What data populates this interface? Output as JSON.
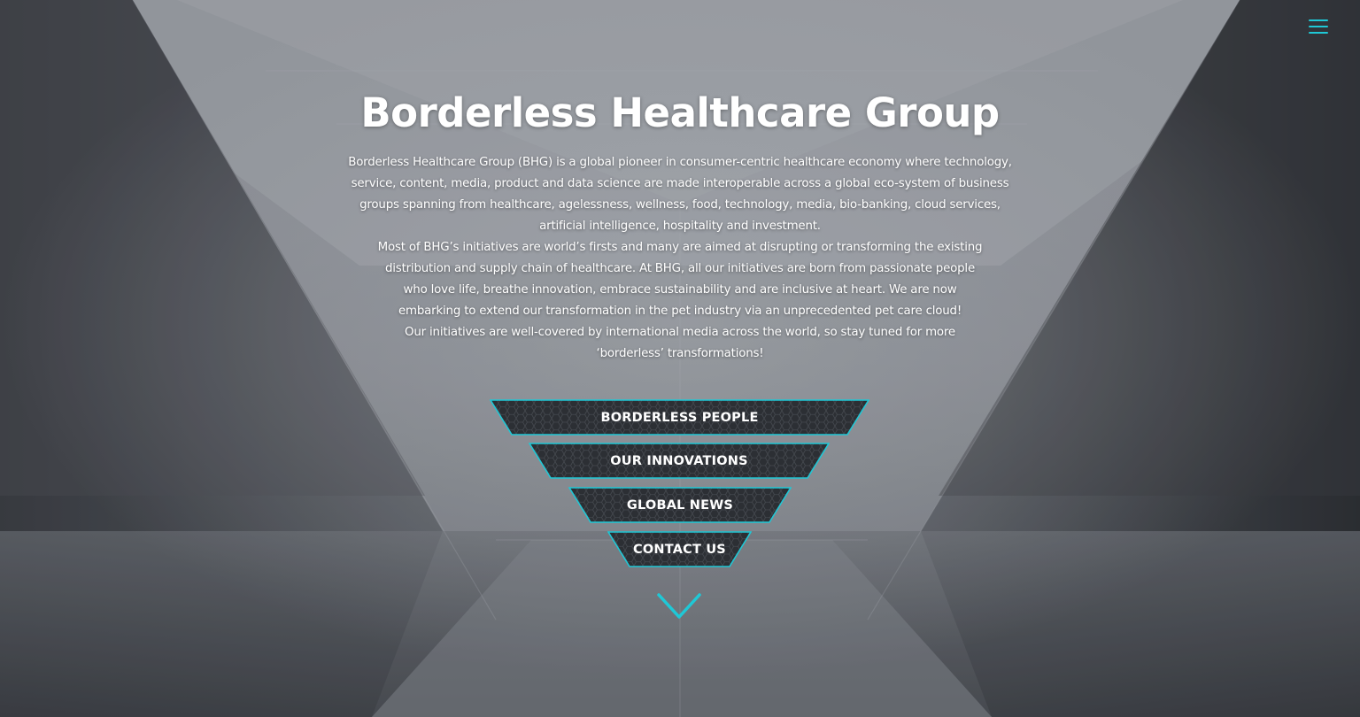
{
  "header": {
    "menu_icon": "hamburger-menu-icon",
    "accent_color": "#1fc8d6"
  },
  "hero": {
    "title": "Borderless Healthcare Group",
    "paragraph_1": "Borderless Healthcare Group (BHG) is a global pioneer in consumer-centric healthcare economy where technology, service, content, media, product and data science are made interoperable across a global eco-system of business groups spanning from healthcare, agelessness, wellness, food, technology, media, bio-banking, cloud services, artificial intelligence, hospitality and investment.",
    "paragraph_2": "Most of BHG’s initiatives are world’s firsts and many are aimed at disrupting or transforming the existing distribution and supply chain of healthcare. At BHG, all our initiatives are born from passionate people who love life, breathe innovation, embrace sustainability and are inclusive at heart. We are now embarking to extend our transformation in the pet industry via an unprecedented pet care cloud!",
    "paragraph_3": "Our initiatives are well-covered by international media across the world, so stay tuned for more ‘borderless’ transformations!"
  },
  "nav": {
    "buttons": [
      {
        "label": "BORDERLESS PEOPLE"
      },
      {
        "label": "OUR INNOVATIONS"
      },
      {
        "label": "GLOBAL NEWS"
      },
      {
        "label": "CONTACT US"
      }
    ],
    "scroll_icon": "chevron-down-icon"
  },
  "colors": {
    "button_fill": "#2c2f34",
    "button_border": "#1fc8d6",
    "text": "#ffffff"
  }
}
